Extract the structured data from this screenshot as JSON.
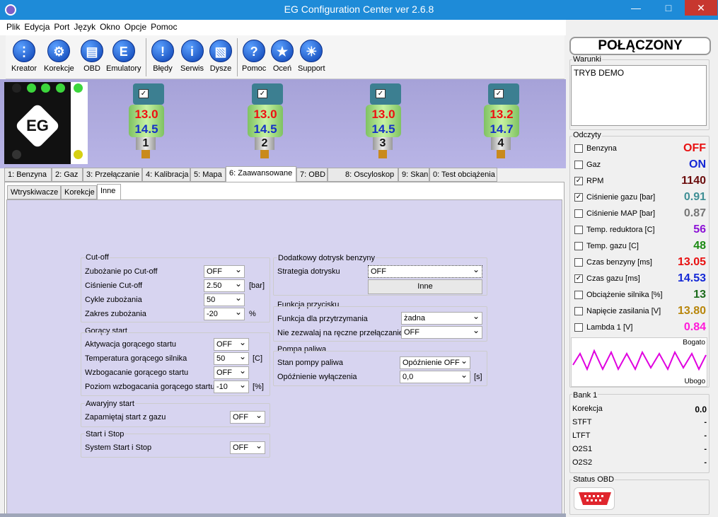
{
  "window": {
    "title": "EG Configuration Center ver 2.6.8"
  },
  "menu": [
    "Plik",
    "Edycja",
    "Port",
    "Język",
    "Okno",
    "Opcje",
    "Pomoc"
  ],
  "toolbar": {
    "kreator": "Kreator",
    "korekcje": "Korekcje",
    "obd": "OBD",
    "emulatory": "Emulatory",
    "bledy": "Błędy",
    "serwis": "Serwis",
    "dysze": "Dysze",
    "pomoc": "Pomoc",
    "ocen": "Oceń",
    "support": "Support"
  },
  "injectors": [
    {
      "n": "1",
      "v1": "13.0",
      "v2": "14.5",
      "checked": true
    },
    {
      "n": "2",
      "v1": "13.0",
      "v2": "14.5",
      "checked": true
    },
    {
      "n": "3",
      "v1": "13.0",
      "v2": "14.5",
      "checked": true
    },
    {
      "n": "4",
      "v1": "13.2",
      "v2": "14.7",
      "checked": true
    }
  ],
  "logo_text": "EG",
  "tabs": [
    "1: Benzyna",
    "2: Gaz",
    "3: Przełączanie",
    "4: Kalibracja",
    "5: Mapa",
    "6: Zaawansowane",
    "7: OBD",
    "8: Oscyloskop",
    "9: Skan",
    "0: Test obciążenia"
  ],
  "subtabs": [
    "Wtryskiwacze",
    "Korekcje",
    "Inne"
  ],
  "cutoff": {
    "title": "Cut-off",
    "rows": [
      {
        "label": "Zubożanie po Cut-off",
        "value": "OFF",
        "unit": ""
      },
      {
        "label": "Ciśnienie Cut-off",
        "value": "2.50",
        "unit": "[bar]"
      },
      {
        "label": "Cykle zubożania",
        "value": "50",
        "unit": ""
      },
      {
        "label": "Zakres zubożania",
        "value": "-20",
        "unit": "%"
      }
    ]
  },
  "hotstart": {
    "title": "Gorący start",
    "rows": [
      {
        "label": "Aktywacja gorącego startu",
        "value": "OFF",
        "unit": ""
      },
      {
        "label": "Temperatura gorącego silnika",
        "value": "50",
        "unit": "[C]"
      },
      {
        "label": "Wzbogacanie gorącego startu",
        "value": "OFF",
        "unit": ""
      },
      {
        "label": "Poziom wzbogacania gorącego startu",
        "value": "-10",
        "unit": "[%]"
      }
    ]
  },
  "emergency": {
    "title": "Awaryjny start",
    "label": "Zapamiętaj start z gazu",
    "value": "OFF"
  },
  "startstop": {
    "title": "Start i Stop",
    "label": "System Start i Stop",
    "value": "OFF"
  },
  "petrol": {
    "title": "Dodatkowy dotrysk benzyny",
    "label": "Strategia dotrysku",
    "value": "OFF",
    "button": "Inne"
  },
  "button_fn": {
    "title": "Funkcja przycisku",
    "rows": [
      {
        "label": "Funkcja dla przytrzymania",
        "value": "żadna"
      },
      {
        "label": "Nie zezwalaj na ręczne przełączanie",
        "value": "OFF"
      }
    ]
  },
  "pump": {
    "title": "Pompa paliwa",
    "rows": [
      {
        "label": "Stan pompy paliwa",
        "value": "Opóźnienie OFF",
        "unit": ""
      },
      {
        "label": "Opóźnienie wyłączenia",
        "value": "0,0",
        "unit": "[s]"
      }
    ]
  },
  "status": {
    "connected": "POŁĄCZONY",
    "warunki_title": "Warunki",
    "warunki_text": "TRYB DEMO",
    "odczyty_title": "Odczyty"
  },
  "readings": [
    {
      "name": "Benzyna",
      "value": "OFF",
      "checked": false,
      "color": "#e81010"
    },
    {
      "name": "Gaz",
      "value": "ON",
      "checked": false,
      "color": "#1428d6"
    },
    {
      "name": "RPM",
      "value": "1140",
      "checked": true,
      "color": "#6b0d0d"
    },
    {
      "name": "Ciśnienie gazu [bar]",
      "value": "0.91",
      "checked": true,
      "color": "#3f8f95"
    },
    {
      "name": "Ciśnienie MAP [bar]",
      "value": "0.87",
      "checked": false,
      "color": "#777777"
    },
    {
      "name": "Temp. reduktora [C]",
      "value": "56",
      "checked": false,
      "color": "#8c12d6"
    },
    {
      "name": "Temp. gazu [C]",
      "value": "48",
      "checked": false,
      "color": "#1a8a12"
    },
    {
      "name": "Czas benzyny [ms]",
      "value": "13.05",
      "checked": false,
      "color": "#e81010"
    },
    {
      "name": "Czas gazu [ms]",
      "value": "14.53",
      "checked": true,
      "color": "#1428d6"
    },
    {
      "name": "Obciążenie silnika [%]",
      "value": "13",
      "checked": false,
      "color": "#1c6b1c"
    },
    {
      "name": "Napięcie zasilania [V]",
      "value": "13.80",
      "checked": false,
      "color": "#b8860b"
    },
    {
      "name": "Lambda 1 [V]",
      "value": "0.84",
      "checked": false,
      "color": "#ff1ad9"
    }
  ],
  "lambda_chart": {
    "top_label": "Bogato",
    "bottom_label": "Ubogo",
    "color": "#e000e0"
  },
  "bank": {
    "title": "Bank 1",
    "rows": [
      {
        "label": "Korekcja",
        "value": "0.0"
      },
      {
        "label": "STFT",
        "value": "-"
      },
      {
        "label": "LTFT",
        "value": "-"
      },
      {
        "label": "O2S1",
        "value": "-"
      },
      {
        "label": "O2S2",
        "value": "-"
      }
    ]
  },
  "obd_status": {
    "title": "Status OBD"
  }
}
